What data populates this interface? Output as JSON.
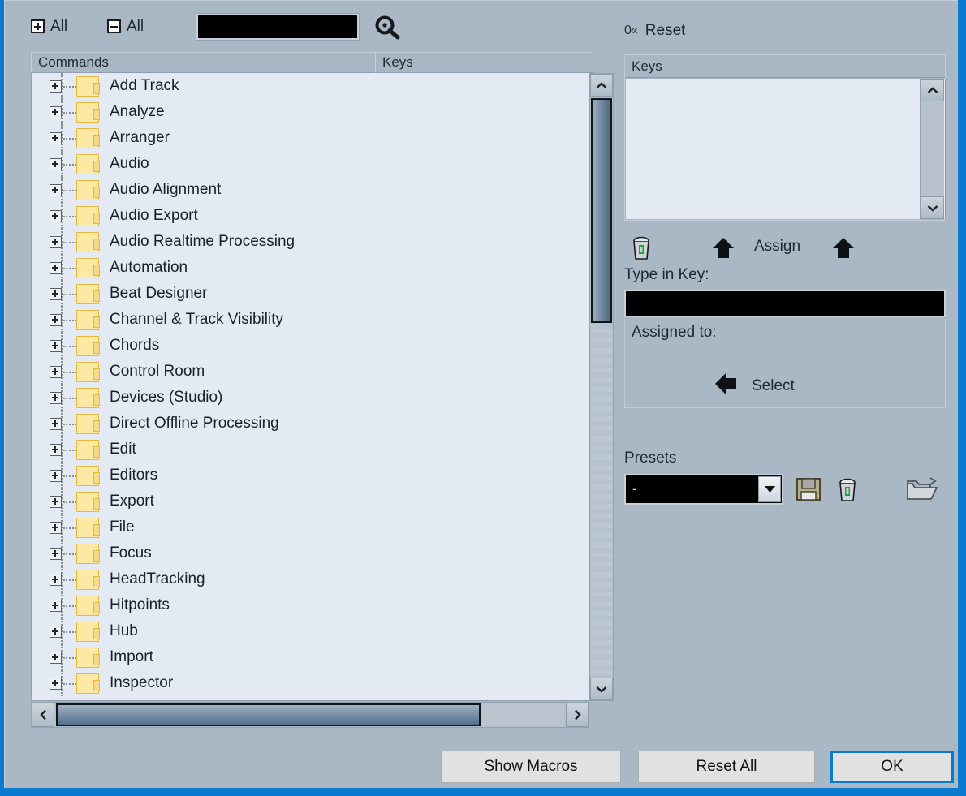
{
  "toolbar": {
    "expand_all_label": "All",
    "collapse_all_label": "All",
    "search_value": "",
    "search_placeholder": "",
    "search_icon": "magnifier-plus-icon"
  },
  "columns": {
    "commands_header": "Commands",
    "keys_header": "Keys"
  },
  "tree": {
    "items": [
      {
        "label": "Add Track"
      },
      {
        "label": "Analyze"
      },
      {
        "label": "Arranger"
      },
      {
        "label": "Audio"
      },
      {
        "label": "Audio Alignment"
      },
      {
        "label": "Audio Export"
      },
      {
        "label": "Audio Realtime Processing"
      },
      {
        "label": "Automation"
      },
      {
        "label": "Beat Designer"
      },
      {
        "label": "Channel & Track Visibility"
      },
      {
        "label": "Chords"
      },
      {
        "label": "Control Room"
      },
      {
        "label": "Devices (Studio)"
      },
      {
        "label": "Direct Offline Processing"
      },
      {
        "label": "Edit"
      },
      {
        "label": "Editors"
      },
      {
        "label": "Export"
      },
      {
        "label": "File"
      },
      {
        "label": "Focus"
      },
      {
        "label": "HeadTracking"
      },
      {
        "label": "Hitpoints"
      },
      {
        "label": "Hub"
      },
      {
        "label": "Import"
      },
      {
        "label": "Inspector"
      }
    ]
  },
  "right_panel": {
    "reset_glyph": "0«",
    "reset_label": "Reset",
    "keys_header": "Keys",
    "keys_items": [],
    "delete_icon": "trash-icon",
    "assign_label": "Assign",
    "type_in_key_label": "Type in Key:",
    "type_in_key_value": "",
    "assigned_to_label": "Assigned to:",
    "select_label": "Select",
    "presets_title": "Presets",
    "presets_value": "-",
    "presets_save_icon": "floppy-save-icon",
    "presets_delete_icon": "trash-icon",
    "presets_open_icon": "open-folder-icon"
  },
  "footer": {
    "show_macros_label": "Show Macros",
    "reset_all_label": "Reset All",
    "ok_label": "OK"
  },
  "colors": {
    "window_bg": "#aab8c6",
    "list_bg": "#e4eaf3",
    "accent_blue": "#0a7ad1",
    "folder_yellow": "#fde8a4",
    "input_black": "#000000"
  }
}
